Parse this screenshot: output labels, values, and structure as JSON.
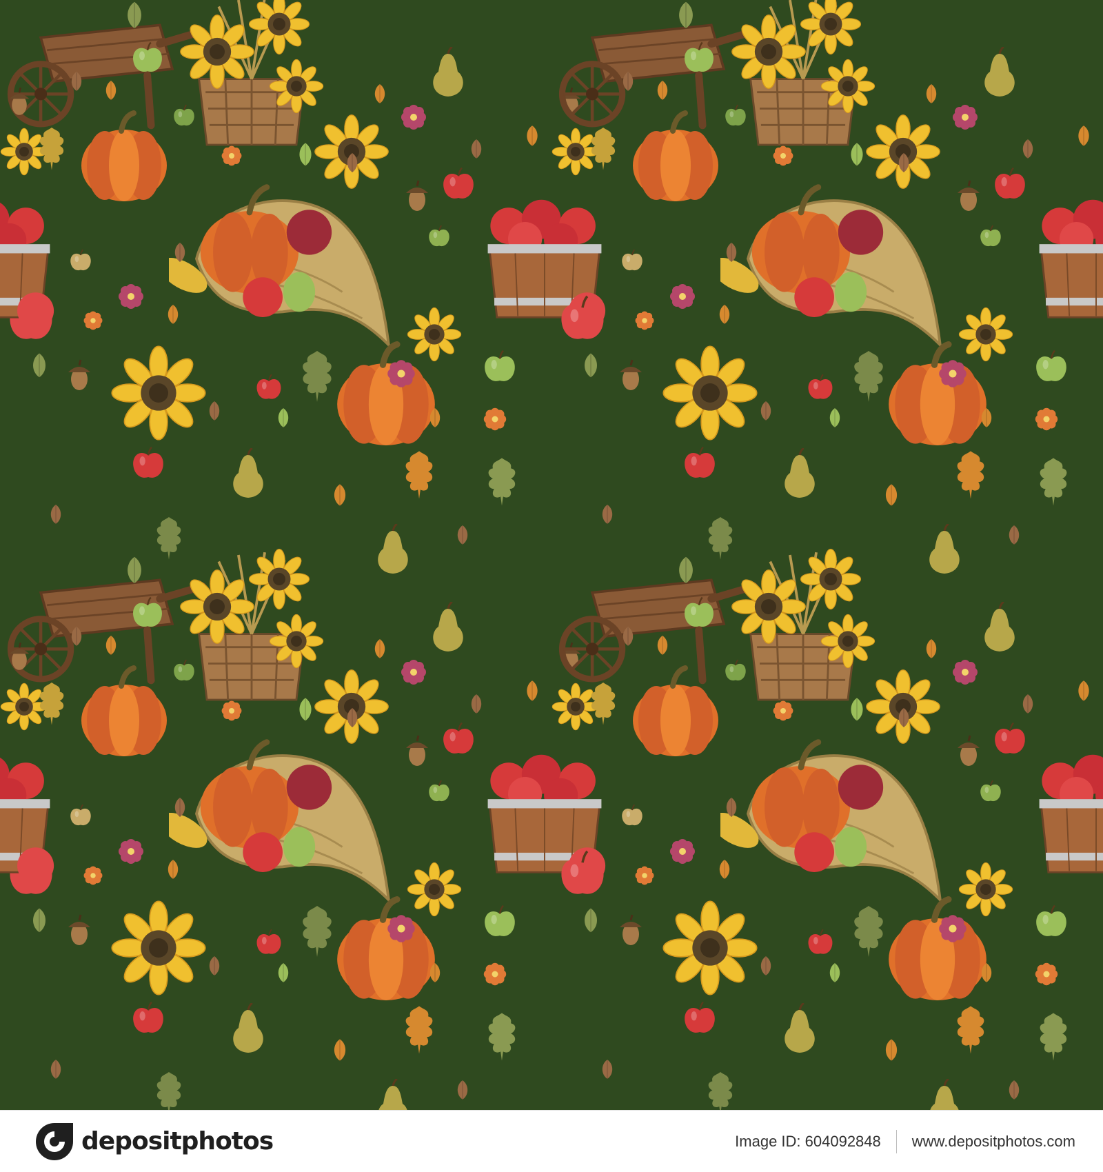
{
  "artwork": {
    "background_color": "#2f4a1f",
    "motifs": [
      "pumpkin-icon",
      "sunflower-icon",
      "apple-icon",
      "pear-icon",
      "acorn-icon",
      "leaf-icon",
      "wheelbarrow-icon",
      "cornucopia-icon",
      "apple-bucket-icon",
      "flower-basket-icon"
    ],
    "colors": {
      "pumpkin": "#e0702a",
      "sunflower_petal": "#f0c02f",
      "sunflower_center": "#5a4628",
      "apple_red": "#d63a3a",
      "apple_green": "#9bbf5a",
      "pear": "#b7a74a",
      "wood": "#8a5a36",
      "leaf_orange": "#d6892f",
      "leaf_brown": "#9a6a45"
    }
  },
  "footer": {
    "brand_name": "depositphotos",
    "image_id": "Image ID: 604092848",
    "url": "www.depositphotos.com"
  }
}
